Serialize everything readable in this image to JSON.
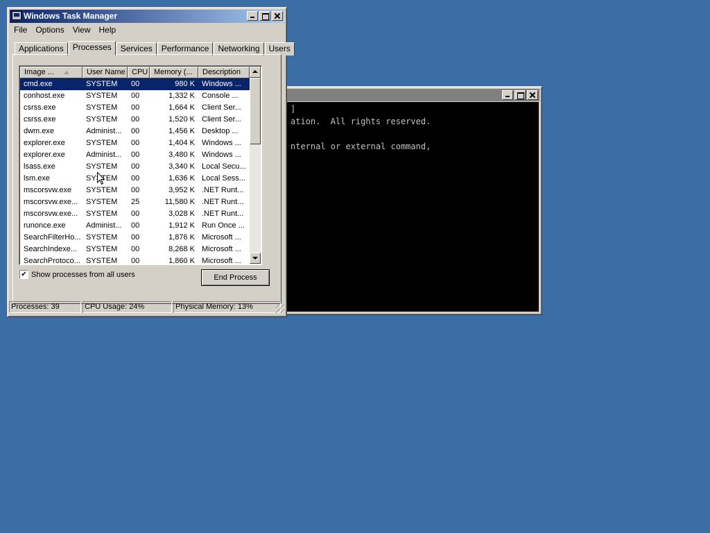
{
  "console": {
    "lines": [
      "]",
      "ation.  All rights reserved.",
      "",
      "nternal or external command,"
    ]
  },
  "task_manager": {
    "title": "Windows Task Manager",
    "menu": [
      "File",
      "Options",
      "View",
      "Help"
    ],
    "tabs": [
      "Applications",
      "Processes",
      "Services",
      "Performance",
      "Networking",
      "Users"
    ],
    "active_tab": "Processes",
    "columns": [
      "Image ...",
      "User Name",
      "CPU",
      "Memory (...",
      "Description"
    ],
    "rows": [
      {
        "image": "cmd.exe",
        "user": "SYSTEM",
        "cpu": "00",
        "mem": "980 K",
        "desc": "Windows ...",
        "selected": true
      },
      {
        "image": "conhost.exe",
        "user": "SYSTEM",
        "cpu": "00",
        "mem": "1,332 K",
        "desc": "Console ..."
      },
      {
        "image": "csrss.exe",
        "user": "SYSTEM",
        "cpu": "00",
        "mem": "1,664 K",
        "desc": "Client Ser..."
      },
      {
        "image": "csrss.exe",
        "user": "SYSTEM",
        "cpu": "00",
        "mem": "1,520 K",
        "desc": "Client Ser..."
      },
      {
        "image": "dwm.exe",
        "user": "Administ...",
        "cpu": "00",
        "mem": "1,456 K",
        "desc": "Desktop ..."
      },
      {
        "image": "explorer.exe",
        "user": "SYSTEM",
        "cpu": "00",
        "mem": "1,404 K",
        "desc": "Windows ..."
      },
      {
        "image": "explorer.exe",
        "user": "Administ...",
        "cpu": "00",
        "mem": "3,480 K",
        "desc": "Windows ..."
      },
      {
        "image": "lsass.exe",
        "user": "SYSTEM",
        "cpu": "00",
        "mem": "3,340 K",
        "desc": "Local Secu..."
      },
      {
        "image": "lsm.exe",
        "user": "SYSTEM",
        "cpu": "00",
        "mem": "1,636 K",
        "desc": "Local Sess..."
      },
      {
        "image": "mscorsvw.exe",
        "user": "SYSTEM",
        "cpu": "00",
        "mem": "3,952 K",
        "desc": ".NET Runt..."
      },
      {
        "image": "mscorsvw.exe...",
        "user": "SYSTEM",
        "cpu": "25",
        "mem": "11,580 K",
        "desc": ".NET Runt..."
      },
      {
        "image": "mscorsvw.exe...",
        "user": "SYSTEM",
        "cpu": "00",
        "mem": "3,028 K",
        "desc": ".NET Runt..."
      },
      {
        "image": "runonce.exe",
        "user": "Administ...",
        "cpu": "00",
        "mem": "1,912 K",
        "desc": "Run Once ..."
      },
      {
        "image": "SearchFilterHo...",
        "user": "SYSTEM",
        "cpu": "00",
        "mem": "1,876 K",
        "desc": "Microsoft ..."
      },
      {
        "image": "SearchIndexe...",
        "user": "SYSTEM",
        "cpu": "00",
        "mem": "8,268 K",
        "desc": "Microsoft ..."
      },
      {
        "image": "SearchProtoco...",
        "user": "SYSTEM",
        "cpu": "00",
        "mem": "1,860 K",
        "desc": "Microsoft ..."
      }
    ],
    "show_all_label": "Show processes from all users",
    "show_all_checked": "✔",
    "end_process_label": "End Process",
    "status": {
      "processes": "Processes: 39",
      "cpu": "CPU Usage: 24%",
      "memory": "Physical Memory: 13%"
    }
  },
  "colors": {
    "desktop": "#3a6ea5",
    "selection": "#0a246a",
    "titlebar_active": "#0a246a",
    "face": "#d4d0c8"
  }
}
